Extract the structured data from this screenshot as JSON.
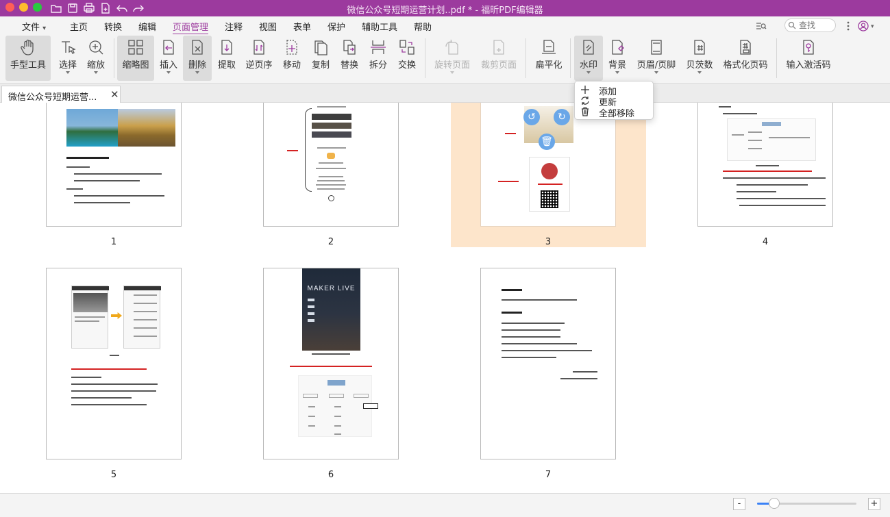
{
  "window": {
    "title": "微信公众号短期运营计划..pdf * - 福昕PDF编辑器"
  },
  "menu": {
    "file": "文件",
    "items": [
      "主页",
      "转换",
      "编辑",
      "页面管理",
      "注释",
      "视图",
      "表单",
      "保护",
      "辅助工具",
      "帮助"
    ],
    "active": "页面管理",
    "search_placeholder": "查找"
  },
  "ribbon": {
    "hand": "手型工具",
    "select": "选择",
    "zoom": "缩放",
    "thumbnail": "缩略图",
    "insert": "插入",
    "delete": "删除",
    "extract": "提取",
    "reverse": "逆页序",
    "move": "移动",
    "copy": "复制",
    "replace": "替换",
    "split": "拆分",
    "swap": "交换",
    "rotate": "旋转页面",
    "crop": "裁剪页面",
    "flatten": "扁平化",
    "watermark": "水印",
    "background": "背景",
    "header_footer": "页眉/页脚",
    "bates": "贝茨数",
    "format_page_number": "格式化页码",
    "activation": "输入激活码"
  },
  "tab": {
    "label": "微信公众号短期运营..."
  },
  "watermark_menu": {
    "add": "添加",
    "update": "更新",
    "remove_all": "全部移除"
  },
  "pages": [
    {
      "number": "1"
    },
    {
      "number": "2"
    },
    {
      "number": "3",
      "selected": true
    },
    {
      "number": "4"
    },
    {
      "number": "5"
    },
    {
      "number": "6",
      "banner": "MAKER LIVE"
    },
    {
      "number": "7"
    }
  ],
  "zoom": {
    "minus": "-",
    "plus": "+",
    "level": 0.17
  },
  "colors": {
    "accent": "#9c3a9e",
    "selection": "#fde5cb",
    "slider": "#3b82f6"
  }
}
